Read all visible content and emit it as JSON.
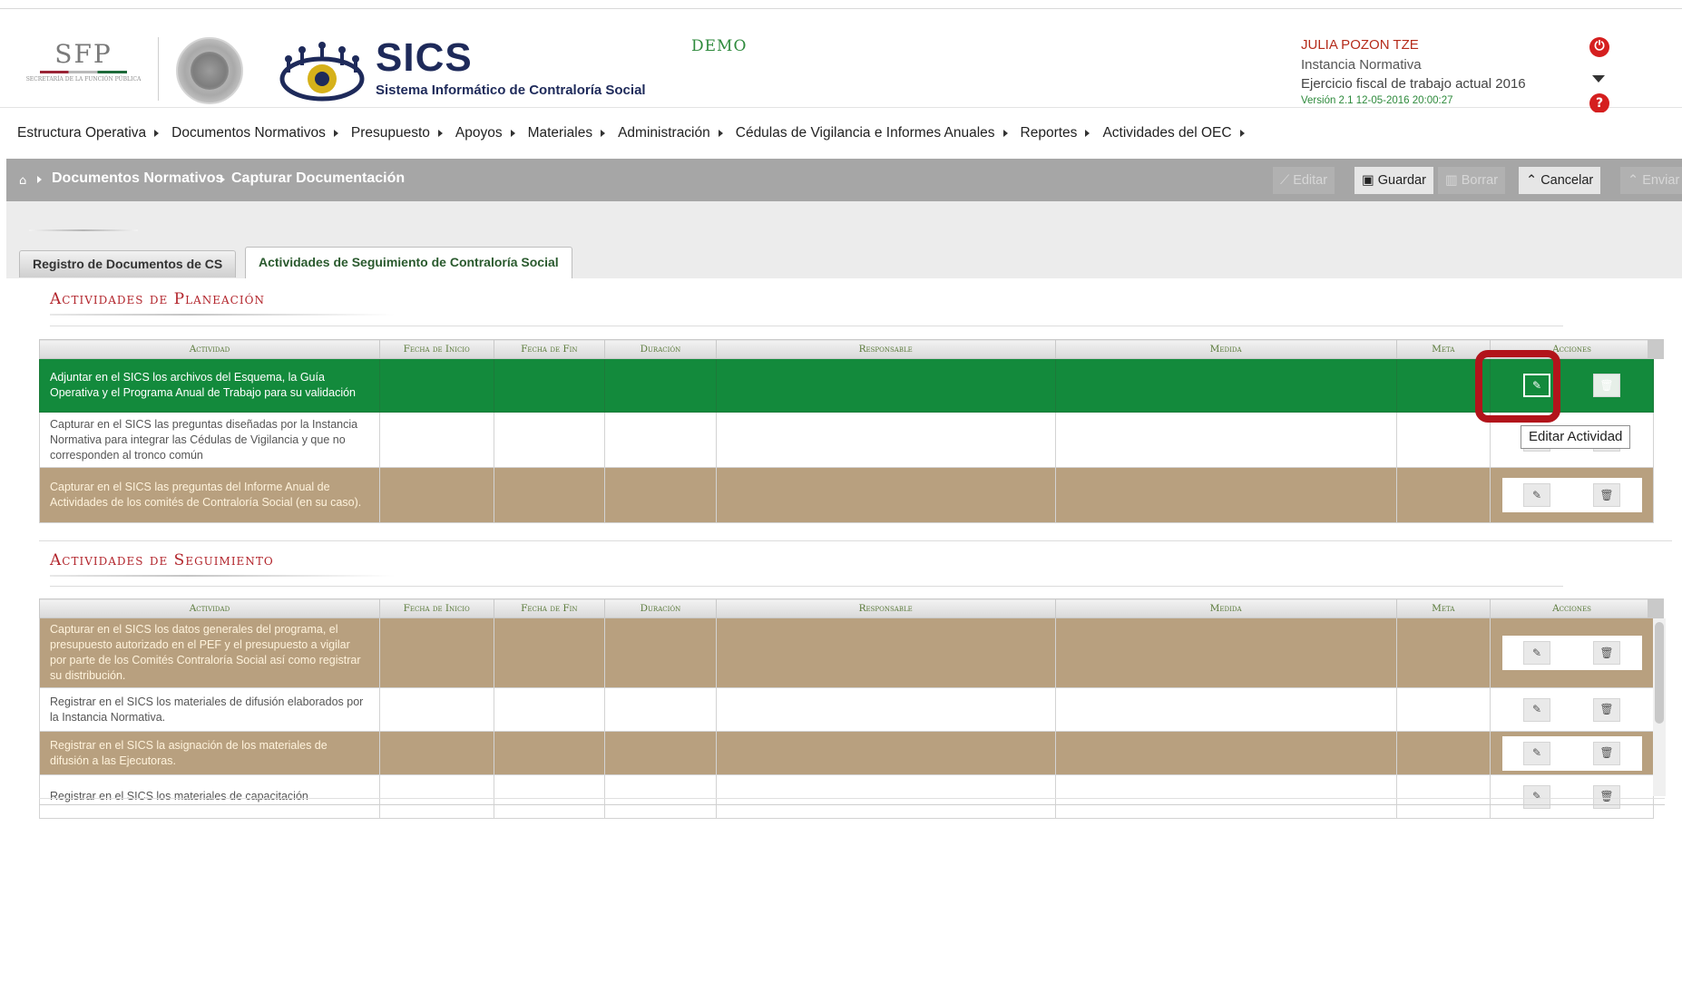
{
  "header": {
    "sfp_logo_text": "SFP",
    "sfp_logo_small": "SECRETARÍA DE LA FUNCIÓN PÚBLICA",
    "app_name": "SICS",
    "app_subtitle": "Sistema Informático de Contraloría Social",
    "env_label": "DEMO",
    "user_name": "JULIA POZON TZE",
    "user_role": "Instancia Normativa",
    "fiscal_year": "Ejercicio fiscal de trabajo actual  2016",
    "version": "Versión 2.1    12-05-2016 20:00:27"
  },
  "menu": [
    "Estructura Operativa",
    "Documentos Normativos",
    "Presupuesto",
    "Apoyos",
    "Materiales",
    "Administración",
    "Cédulas de Vigilancia e Informes Anuales",
    "Reportes",
    "Actividades del OEC"
  ],
  "breadcrumb": {
    "level1": "Documentos Normativos",
    "level2": "Capturar Documentación"
  },
  "toolbar": {
    "edit": "Editar",
    "save": "Guardar",
    "delete": "Borrar",
    "cancel": "Cancelar",
    "send": "Enviar"
  },
  "tabs": {
    "tab1": "Registro de Documentos de CS",
    "tab2": "Actividades de Seguimiento de Contraloría Social"
  },
  "columns": [
    "Actividad",
    "Fecha de Inicio",
    "Fecha de Fin",
    "Duración",
    "Responsable",
    "Medida",
    "Meta",
    "Acciones"
  ],
  "planeacion": {
    "title": "Actividades de Planeación",
    "rows": [
      "Adjuntar en el SICS los archivos del Esquema, la Guía Operativa y el Programa Anual de Trabajo para su validación",
      "Capturar en el SICS las preguntas diseñadas por la Instancia Normativa para integrar las Cédulas de Vigilancia y que no corresponden al tronco común",
      "Capturar en el SICS las preguntas del Informe Anual de Actividades de los comités de Contraloría Social (en su caso)."
    ]
  },
  "seguimiento": {
    "title": "Actividades de Seguimiento",
    "rows": [
      "Capturar en el SICS los datos generales del programa, el presupuesto autorizado en el PEF y el presupuesto a vigilar por parte de los Comités Contraloría Social así como registrar su distribución.",
      "Registrar en el SICS los materiales de difusión elaborados por la Instancia Normativa.",
      "Registrar en el SICS la asignación de los materiales de difusión a las Ejecutoras.",
      "Registrar en el SICS los materiales de capacitación"
    ]
  },
  "tooltip": "Editar Actividad",
  "icons": {
    "home": "home-icon",
    "edit": "pencil-icon",
    "delete": "trash-icon",
    "save": "floppy-icon",
    "power": "power-icon",
    "help": "help-icon"
  },
  "colors": {
    "selected_row": "#138a3c",
    "alt_row": "#b8a07f",
    "section_title": "#b2242b",
    "highlight": "#b2141b"
  }
}
